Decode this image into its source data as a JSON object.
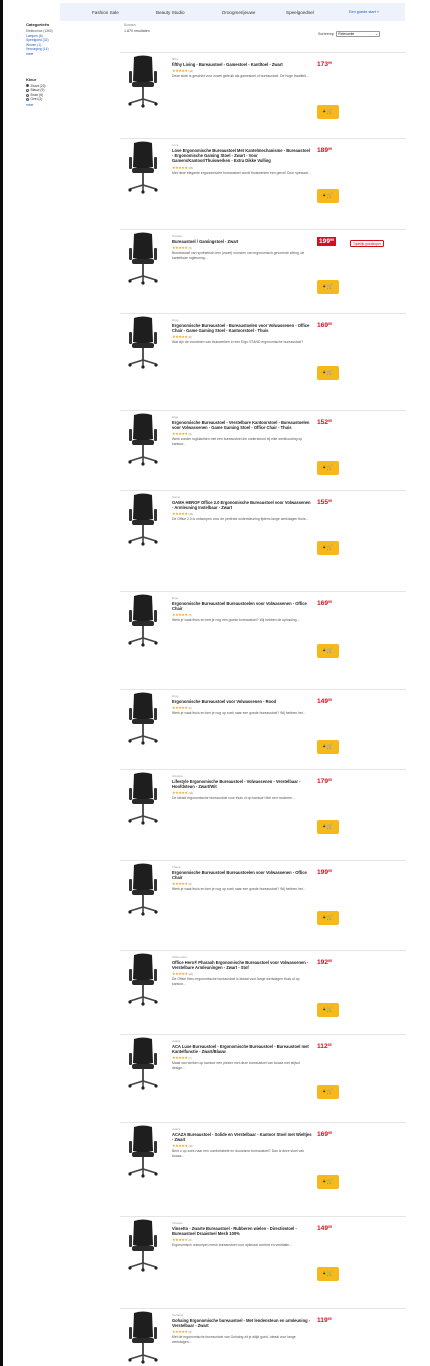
{
  "nav": {
    "items": [
      "Fashion Sale",
      "Beauty Studio",
      "Droogmerijeuwe",
      "Speelgoedsel"
    ],
    "cta": "Een goede start »"
  },
  "results": {
    "crumb": "Bureaus",
    "count": "1.870 resultaten"
  },
  "sort": {
    "label": "Sorteerop",
    "value": "Relevantie"
  },
  "sidebar": {
    "categories_title": "Categorieën",
    "categories": [
      "Elektronica (1360)",
      "Lampen (6)",
      "Speelgoed (32)",
      "Wonen (1)",
      "Verzorging (14)",
      "meer"
    ],
    "color_title": "Kleur",
    "colors": [
      {
        "label": "Zwart (23)",
        "selected": true
      },
      {
        "label": "Blauw (9)",
        "selected": false
      },
      {
        "label": "Bruin (6)",
        "selected": false
      },
      {
        "label": "Geel (2)",
        "selected": false
      }
    ],
    "reset": "meer"
  },
  "cart_label": "+",
  "products": [
    {
      "brand": "fifthy",
      "title": "fifthy Living - Bureaustoel - Gamestoel - Kantltoel - Zwart",
      "rating": "★★★★★",
      "reviews": "(12)",
      "desc": "Deze stoel is geschikt voor zowel gebruik als gamestoel of bureaustoel. De hoge kwaliteit...",
      "price": "173",
      "cents": "99",
      "sale": false,
      "badge": ""
    },
    {
      "brand": "Love",
      "title": "Love Ergonomische Bureaustoel Met Kantelmechanisme - Bureaustoel - Ergonomische Gaming Stoel - Zwart - Voor Gamers/Kantoor/Thuiswerken - Extra Dikke Vulling",
      "rating": "★★★★★",
      "reviews": "(25)",
      "desc": "Met deze elegante ergonomische bureaustoel wordt thuiswerken een genot! Door speciaal...",
      "price": "189",
      "cents": "99",
      "sale": false,
      "badge": ""
    },
    {
      "brand": "Tectake",
      "title": "Bureaustoel / Gamingstoel - Zwart",
      "rating": "★★★★★",
      "reviews": "(3)",
      "desc": "Bureaustoel van synthetisch leer (zwart) voorzien van ergonomisch gevormde zitting, de kantelbare rugleuning...",
      "price": "199",
      "cents": "99",
      "sale": true,
      "badge": "Tijdelijk goedkoper"
    },
    {
      "brand": "Ergo",
      "title": "Ergonomische Bureaustoel - Bureaustoelen voor Volwassenen - Office Chair - Game Gaming Stoel - Kantoorstoel - Thuis",
      "rating": "★★★★★",
      "reviews": "(8)",
      "desc": "Wat zijn de voordelen van thuiswerken in een Ergo STAND ergonomische bureaustoel?",
      "price": "169",
      "cents": "95",
      "sale": false,
      "badge": ""
    },
    {
      "brand": "Ergo",
      "title": "Ergonomische Bureaustoel - Verstelbare Kantoorstoel - Bureaustoelen voor Volwassenen - Game Gaming Stoel - Office Chair - Thuis",
      "rating": "★★★★★",
      "reviews": "(4)",
      "desc": "Werk zonder rugklachten met een bureaustoel die ondersteunt bij elke werkhouding op kantoor...",
      "price": "152",
      "cents": "95",
      "sale": false,
      "badge": ""
    },
    {
      "brand": "Gamo",
      "title": "GAMA HEROF Office 2.0 Ergonomische Bureaustoel voor Volwassenen - Armleuning Instelbaar - Zwart",
      "rating": "★★★★★",
      "reviews": "(16)",
      "desc": "De Office 2.0 is ontworpen voor de perfecte ondersteuning tijdens lange werkdagen thuis...",
      "price": "155",
      "cents": "95",
      "sale": false,
      "badge": ""
    },
    {
      "brand": "Ergo",
      "title": "Ergonomische Bureaustoel Bureaustoelen voor Volwassenen - Office Chair",
      "rating": "★★★★★",
      "reviews": "(5)",
      "desc": "Werk je vaak thuis en heb je nog een goede bureaustoel? Wij hebben de oplossing...",
      "price": "169",
      "cents": "95",
      "sale": false,
      "badge": ""
    },
    {
      "brand": "Ergo",
      "title": "Ergonomische Bureaustoel voor Volwassenen - Rood",
      "rating": "★★★★★",
      "reviews": "(6)",
      "desc": "Werk je vaak thuis en ben je nog op zoek naar een goede bureaustoel? Wij hebben het...",
      "price": "149",
      "cents": "95",
      "sale": false,
      "badge": ""
    },
    {
      "brand": "Lifestyle",
      "title": "Lifestyle Ergonomische Bureaustoel - Volwassenen - Verstelbaar - Hoofdsteun - Zwart/Wit",
      "rating": "★★★★★",
      "reviews": "(14)",
      "desc": "De ideale ergonomische bureaustoel voor thuis of op kantoor! Met een moderne...",
      "price": "179",
      "cents": "95",
      "sale": false,
      "badge": ""
    },
    {
      "brand": "Thaue",
      "title": "Ergonomische Bureaustoel Bureaustoelen voor Volwassenen - Office Chair",
      "rating": "★★★★★",
      "reviews": "(9)",
      "desc": "Werk je vaak thuis en ben je nog op zoek naar een goede bureaustoel? Wij hebben het...",
      "price": "199",
      "cents": "95",
      "sale": false,
      "badge": ""
    },
    {
      "brand": "Office Hero",
      "title": "Office Hero® Pharaoh Ergonomische Bureaustoel voor Volwassenen - Verstelbare Armleuningen - Zwart - Stof",
      "rating": "★★★★★",
      "reviews": "(22)",
      "desc": "De Office Hero ergonomische bureaustoel is ideaal voor lange werkdagen thuis of op kantoor...",
      "price": "192",
      "cents": "95",
      "sale": false,
      "badge": ""
    },
    {
      "brand": "Acaza",
      "title": "ACA Luxe Bureaustoel - Ergonomische Bureaustoel - Bureaustoel met Kantelfunctie - Zwart/Blauw",
      "rating": "★★★★★",
      "reviews": "(7)",
      "desc": "Maak van werken op kantoor een plezier met deze bureaustoel van Acaza met stijlvol design...",
      "price": "112",
      "cents": "95",
      "sale": false,
      "badge": ""
    },
    {
      "brand": "Acaza",
      "title": "ACAZA Bureaustoel - Solide en Verstelbaar - Kantoor Stoel met Wieltjes - Zwart",
      "rating": "★★★★★",
      "reviews": "(11)",
      "desc": "Bent u op zoek naar een comfortabele en duurzame bureaustoel? Dan is deze stoel van Acaza...",
      "price": "169",
      "cents": "95",
      "sale": false,
      "badge": ""
    },
    {
      "brand": "Vinsetto",
      "title": "Vinsetto - Zwarte Bureaustoel - Rubberen wielen - Directiestoel - Bureaustoel Draaistoel Mesh 100%",
      "rating": "★★★★★",
      "reviews": "(2)",
      "desc": "Ergonomisch ontworpen mesh bureaustoel voor optimaal comfort en ventilatie...",
      "price": "149",
      "cents": "95",
      "sale": false,
      "badge": ""
    },
    {
      "brand": "Gohaing",
      "title": "Gohaing Ergonomische bureaustoel - Met lendensteun en armleuning - Verstelbaar - Zwart",
      "rating": "★★★★★",
      "reviews": "(5)",
      "desc": "Met de ergonomische bureaustoel van Gohaing zit je altijd goed. Ideaal voor lange werkdagen...",
      "price": "119",
      "cents": "95",
      "sale": false,
      "badge": ""
    }
  ]
}
